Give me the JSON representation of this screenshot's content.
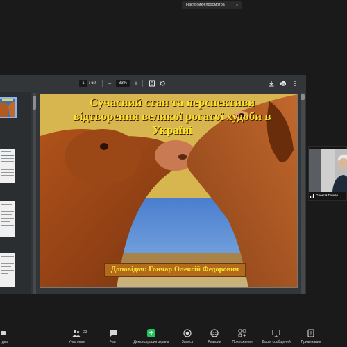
{
  "top": {
    "view_settings": "Настройки просмотра",
    "view_settings_icon": "chevron-down-icon"
  },
  "pdf_toolbar": {
    "page_current": "1",
    "page_total": "/ 60",
    "zoom": "83%",
    "icons": [
      "minus-icon",
      "plus-icon",
      "fit-page-icon",
      "rotate-icon",
      "download-icon",
      "print-icon",
      "more-icon"
    ]
  },
  "slide": {
    "title": "Сучасний стан та перспективи відтворення великої рогатої худоби в Україні",
    "presenter": "Доповідач: Гончар Олексій Федорович"
  },
  "participant": {
    "name": "Олексій Гончар"
  },
  "bottom_bar": {
    "items": [
      {
        "label": "део",
        "icon": "video-icon"
      },
      {
        "label": "Участники",
        "icon": "participants-icon",
        "count": "23"
      },
      {
        "label": "Чат",
        "icon": "chat-icon"
      },
      {
        "label": "Демонстрация экрана",
        "icon": "share-screen-icon"
      },
      {
        "label": "Запись",
        "icon": "record-icon"
      },
      {
        "label": "Реакции",
        "icon": "reactions-icon"
      },
      {
        "label": "Приложения",
        "icon": "apps-icon"
      },
      {
        "label": "Доски сообщений",
        "icon": "whiteboards-icon"
      },
      {
        "label": "Примечания",
        "icon": "notes-icon"
      }
    ]
  },
  "colors": {
    "zoom_share_green": "#23c35e",
    "slide_title_yellow": "#f7e32a",
    "pdf_toolbar_bg": "#323639"
  }
}
